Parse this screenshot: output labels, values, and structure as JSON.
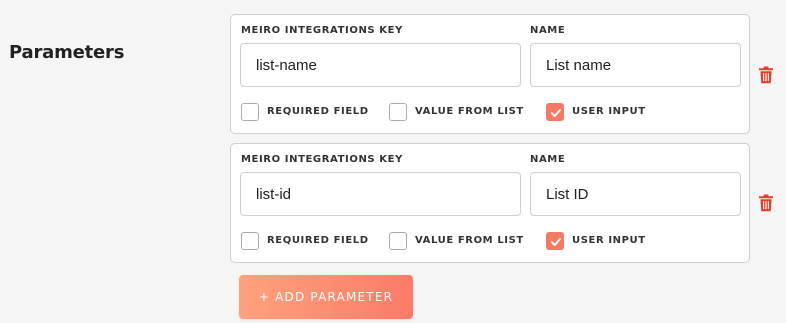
{
  "section": {
    "title": "Parameters"
  },
  "labels": {
    "key": "MEIRO INTEGRATIONS KEY",
    "name": "NAME",
    "required": "REQUIRED FIELD",
    "from_list": "VALUE FROM LIST",
    "user_input": "USER INPUT"
  },
  "parameters": [
    {
      "key": "list-name",
      "name": "List name",
      "required": false,
      "value_from_list": false,
      "user_input": true
    },
    {
      "key": "list-id",
      "name": "List ID",
      "required": false,
      "value_from_list": false,
      "user_input": true
    }
  ],
  "add_button": {
    "label": "+ ADD PARAMETER"
  },
  "colors": {
    "accent": "#f57a63",
    "delete": "#e0402a",
    "button_start": "#fda27c",
    "button_end": "#fb7a68"
  },
  "icons": {
    "delete": "trash-icon",
    "check": "checkmark-icon"
  }
}
